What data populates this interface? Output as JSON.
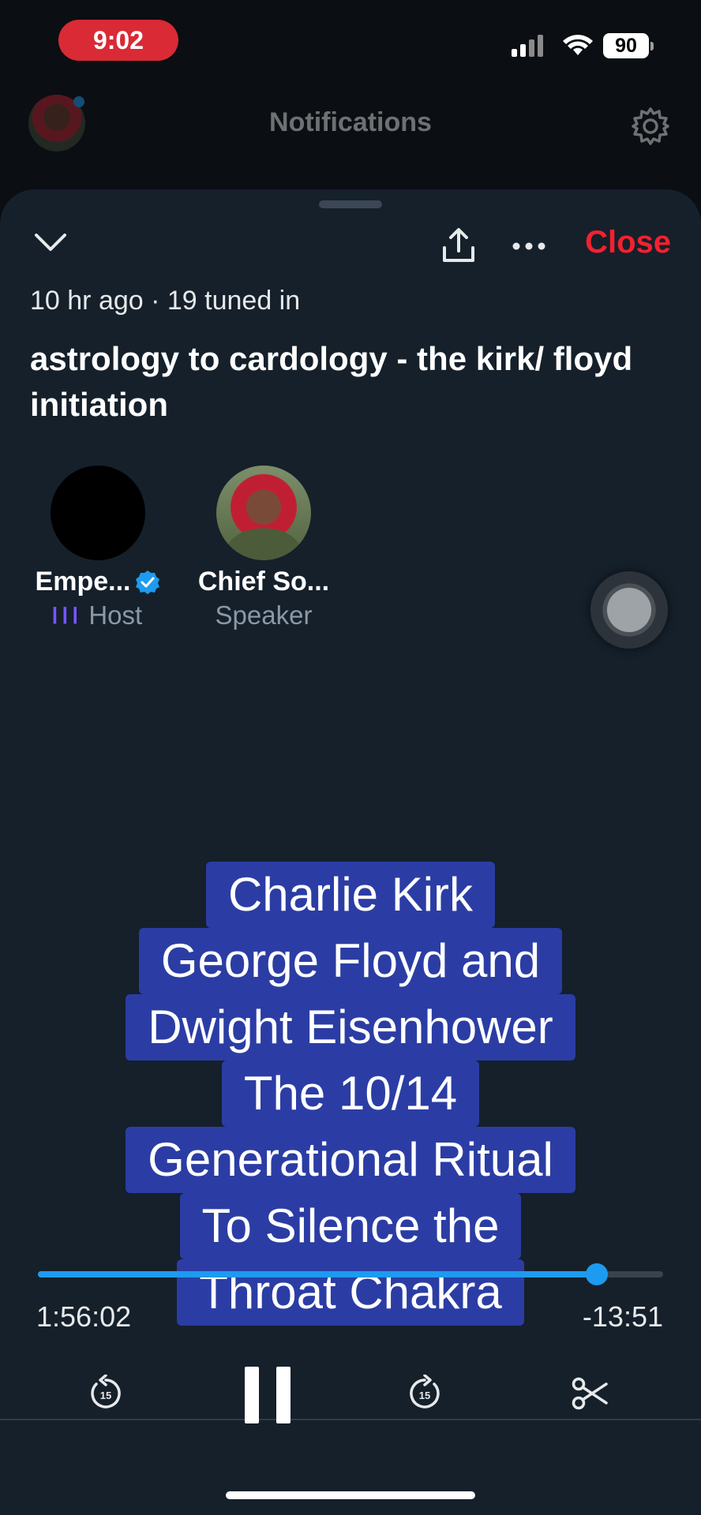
{
  "status_bar": {
    "time": "9:02",
    "battery": "90"
  },
  "background_screen": {
    "title": "Notifications"
  },
  "space": {
    "meta": "10 hr ago · 19 tuned in",
    "title": "astrology to cardology - the kirk/ floyd initiation",
    "close_label": "Close",
    "participants": [
      {
        "name": "Empe...",
        "role": "Host",
        "verified": true
      },
      {
        "name": "Chief So...",
        "role": "Speaker",
        "verified": false
      }
    ],
    "caption_lines": [
      "Charlie Kirk",
      "George Floyd and",
      "Dwight Eisenhower",
      "The 10/14",
      "Generational Ritual",
      "To Silence the",
      "Throat Chakra"
    ]
  },
  "player": {
    "elapsed": "1:56:02",
    "remaining": "-13:51",
    "progress": 0.894,
    "skip_back_seconds": "15",
    "skip_forward_seconds": "15"
  },
  "colors": {
    "accent": "#1d9bf0",
    "close": "#f4212e",
    "caption_bg": "#2b3da4",
    "sheet": "#15202b"
  }
}
